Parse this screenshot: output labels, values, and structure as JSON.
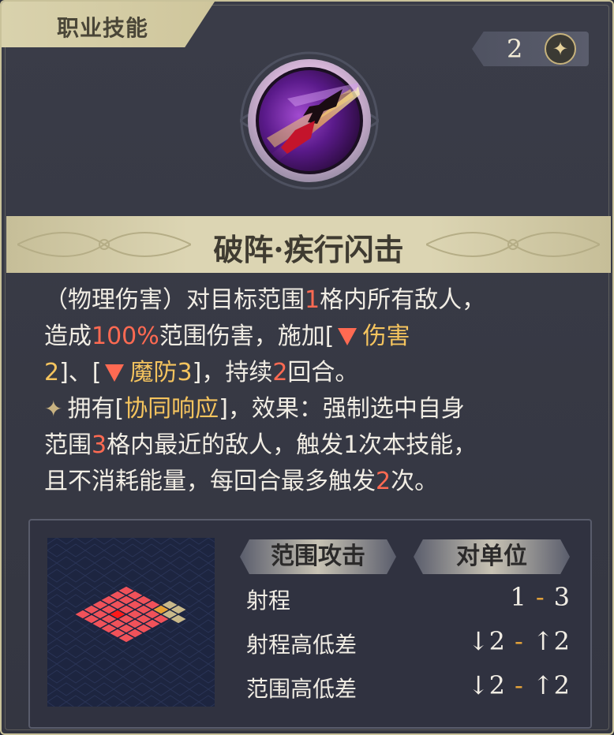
{
  "header": {
    "tab_label": "职业技能"
  },
  "cost": {
    "value": "2",
    "icon": "star-sparkle-icon"
  },
  "skill": {
    "name": "破阵·疾行闪击",
    "icon": "spear-thrust-icon"
  },
  "description": {
    "line1_a": "（物理伤害）对目标范围",
    "line1_range": "1",
    "line1_b": "格内所有敌人，",
    "line2_a": "造成",
    "line2_pct": "100%",
    "line2_b": "范围伤害，施加[",
    "line2_debuff1": "伤害",
    "line3_debuff1_lvl": "2",
    "line3_a": "]、[",
    "line3_debuff2": "魔防3",
    "line3_b": "]，持续",
    "line3_turns": "2",
    "line3_c": "回合。",
    "line4_a": "拥有[",
    "line4_trait": "协同响应",
    "line4_b": "]，效果：强制选中自身",
    "line5_a": "范围",
    "line5_range": "3",
    "line5_b": "格内最近的敌人，触发1次本技能，",
    "line6_a": "且不消耗能量，每回合最多触发",
    "line6_times": "2",
    "line6_b": "次。"
  },
  "attack_info": {
    "tag_area": "范围攻击",
    "tag_target": "对单位",
    "rows": [
      {
        "label": "射程",
        "low": "1",
        "high": "3"
      },
      {
        "label": "射程高低差",
        "low": "↓2",
        "high": "↑2"
      },
      {
        "label": "范围高低差",
        "low": "↓2",
        "high": "↑2"
      }
    ]
  },
  "colors": {
    "highlight_red": "#ff6a52",
    "highlight_gold": "#f5c45e",
    "panel_bg": "#343641",
    "tab_gold": "#d9d2ad"
  }
}
